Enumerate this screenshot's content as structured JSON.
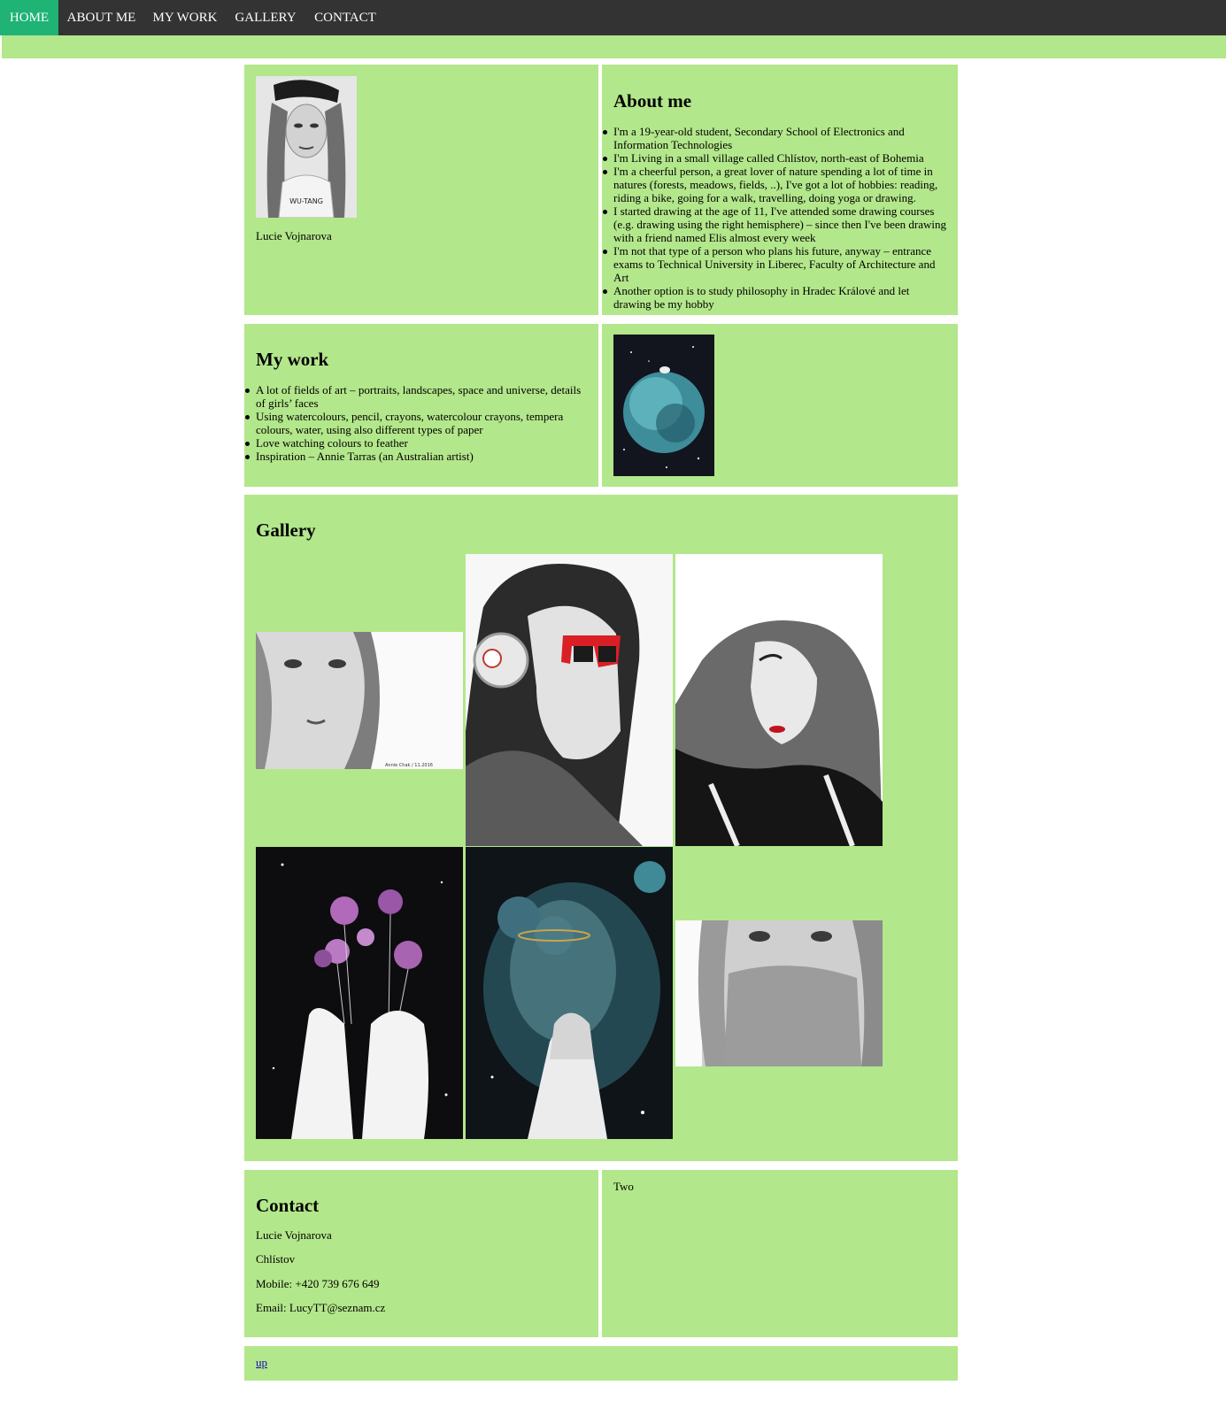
{
  "nav": {
    "items": [
      {
        "label": "HOME",
        "active": true
      },
      {
        "label": "ABOUT ME",
        "active": false
      },
      {
        "label": "MY WORK",
        "active": false
      },
      {
        "label": "GALLERY",
        "active": false
      },
      {
        "label": "CONTACT",
        "active": false
      }
    ]
  },
  "colors": {
    "nav_bg": "#333333",
    "nav_active": "#1fb376",
    "panel": "#b3e78b",
    "link": "#1a0dab"
  },
  "profile": {
    "name": "Lucie Vojnarova",
    "portrait_text": "WU-TANG"
  },
  "about": {
    "heading": "About me",
    "items": [
      "I'm a 19-year-old student, Secondary School of Electronics and Information Technologies",
      "I'm Living in a small village called Chlístov, north-east of Bohemia",
      "I'm a cheerful person, a great lover of nature spending a lot of time in natures (forests, meadows, fields, ..), I've got a lot of hobbies: reading, riding a bike, going for a walk, travelling, doing yoga or drawing.",
      "I started drawing at the age of 11, I've attended some drawing courses (e.g. drawing using the right hemisphere) – since then I've been drawing with a friend named Elis almost every week",
      "I'm not that type of a person who plans his future, anyway – entrance exams to Technical University in Liberec, Faculty of Architecture and Art",
      "Another option is to study philosophy in Hradec Králové and let drawing be my hobby"
    ]
  },
  "work": {
    "heading": "My work",
    "items": [
      "A lot of fields of art – portraits, landscapes, space and universe, details of girls’ faces",
      "Using watercolours, pencil, crayons, watercolour crayons, tempera colours, water, using also different types of paper",
      "Love watching colours to feather",
      "Inspiration – Annie Tarras (an Australian artist)"
    ]
  },
  "gallery": {
    "heading": "Gallery",
    "signature": "Annie Chak / 11.2016"
  },
  "contact": {
    "heading": "Contact",
    "name": "Lucie Vojnarova",
    "town": "Chlístov",
    "mobile": "Mobile: +420 739 676 649",
    "email": "Email: LucyTT@seznam.cz",
    "second_column": "Two"
  },
  "footer": {
    "up_link": "up"
  }
}
